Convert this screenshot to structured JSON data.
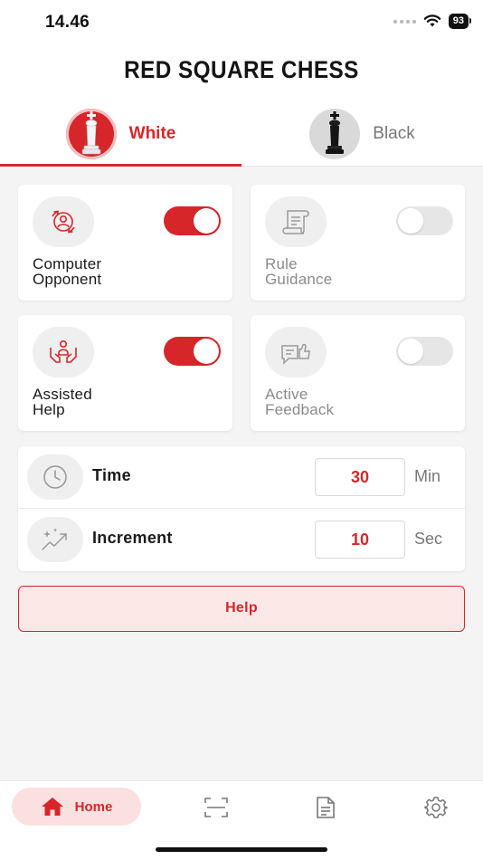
{
  "status_bar": {
    "time": "14.46",
    "battery": "93"
  },
  "app_title": "RED SQUARE CHESS",
  "sides": [
    {
      "label": "White",
      "selected": true
    },
    {
      "label": "Black",
      "selected": false
    }
  ],
  "options": [
    {
      "label_line1": "Computer",
      "label_line2": "Opponent",
      "icon": "robot-opponent-icon",
      "enabled": true
    },
    {
      "label_line1": "Rule",
      "label_line2": "Guidance",
      "icon": "scroll-rules-icon",
      "enabled": false
    },
    {
      "label_line1": "Assisted",
      "label_line2": "Help",
      "icon": "assisted-help-icon",
      "enabled": true
    },
    {
      "label_line1": "Active",
      "label_line2": "Feedback",
      "icon": "feedback-thumbs-icon",
      "enabled": false
    }
  ],
  "time_settings": {
    "time": {
      "label": "Time",
      "value": "30",
      "unit": "Min",
      "icon": "clock-icon"
    },
    "increment": {
      "label": "Increment",
      "value": "10",
      "unit": "Sec",
      "icon": "sparkle-trend-icon"
    }
  },
  "help_button": "Help",
  "bottom_nav": {
    "home_label": "Home",
    "items": [
      "home-icon",
      "scan-icon",
      "document-icon",
      "settings-gear-icon"
    ]
  },
  "colors": {
    "accent": "#d7262a",
    "accent_light": "#fde8e8",
    "background": "#f4f4f4"
  }
}
